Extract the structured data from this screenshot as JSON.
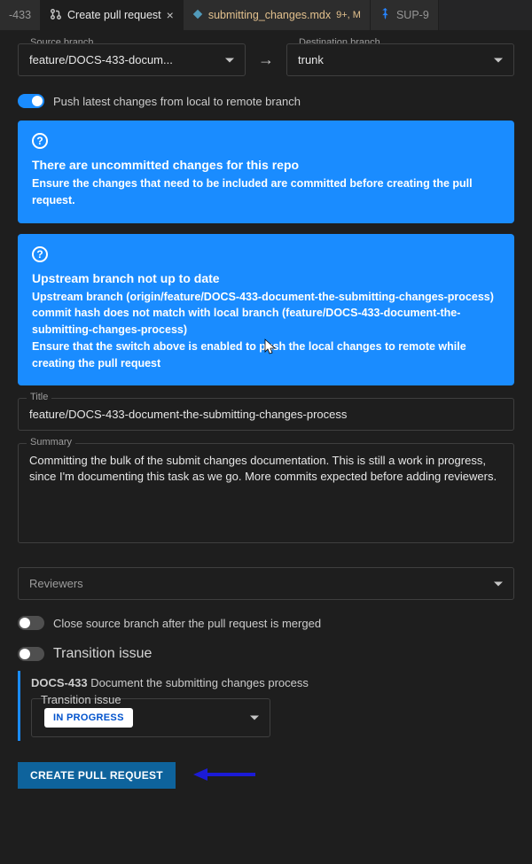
{
  "tabs": {
    "partial": "-433",
    "active": "Create pull request",
    "file": "submitting_changes.mdx",
    "file_mod": "9+, M",
    "sup": "SUP-9"
  },
  "branches": {
    "source_label": "Source branch",
    "source_value": "feature/DOCS-433-docum...",
    "dest_label": "Destination branch",
    "dest_value": "trunk"
  },
  "push_toggle_label": "Push latest changes from local to remote branch",
  "banner1": {
    "title": "There are uncommitted changes for this repo",
    "text": "Ensure the changes that need to be included are committed before creating the pull request."
  },
  "banner2": {
    "title": "Upstream branch not up to date",
    "text": "Upstream branch (origin/feature/DOCS-433-document-the-submitting-changes-process) commit hash does not match with local branch (feature/DOCS-433-document-the-submitting-changes-process)\nEnsure that the switch above is enabled to push the local changes to remote while creating the pull request"
  },
  "title_field": {
    "label": "Title",
    "value": "feature/DOCS-433-document-the-submitting-changes-process"
  },
  "summary_field": {
    "label": "Summary",
    "value": "Committing the bulk of the submit changes documentation. This is still a work in progress, since I'm documenting this task as we go. More commits expected before adding reviewers."
  },
  "reviewers_label": "Reviewers",
  "close_branch_label": "Close source branch after the pull request is merged",
  "transition_heading": "Transition issue",
  "issue": {
    "key": "DOCS-433",
    "summary": "Document the submitting changes process"
  },
  "transition_field_label": "Transition issue",
  "status_value": "IN PROGRESS",
  "create_button": "CREATE PULL REQUEST"
}
